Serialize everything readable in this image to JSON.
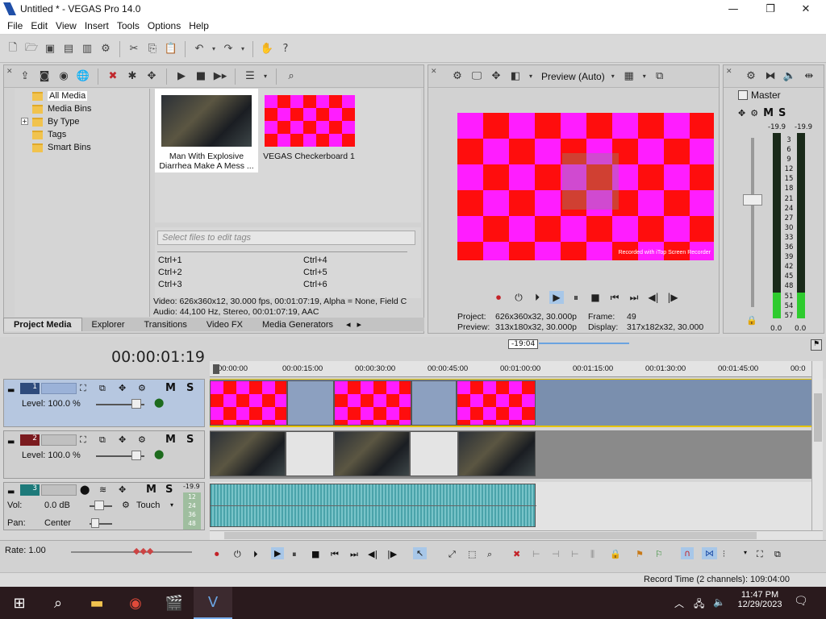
{
  "window": {
    "title": "Untitled * - VEGAS Pro 14.0",
    "minimize": "—",
    "maximize": "❐",
    "close": "✕"
  },
  "menu": [
    "File",
    "Edit",
    "View",
    "Insert",
    "Tools",
    "Options",
    "Help"
  ],
  "project_media": {
    "tree": [
      "All Media",
      "Media Bins",
      "By Type",
      "Tags",
      "Smart Bins"
    ],
    "expander": "+",
    "items": [
      {
        "caption": "Man With Explosive Diarrhea Make A Mess ..."
      },
      {
        "caption": "VEGAS Checkerboard 1"
      }
    ],
    "tag_placeholder": "Select files to edit tags",
    "shortcuts": [
      "Ctrl+1",
      "Ctrl+2",
      "Ctrl+3",
      "Ctrl+4",
      "Ctrl+5",
      "Ctrl+6"
    ],
    "info_line1": "Video: 626x360x12, 30.000 fps, 00:01:07:19, Alpha = None, Field C",
    "info_line2": "Audio: 44,100 Hz, Stereo, 00:01:07:19, AAC"
  },
  "tabs": [
    "Project Media",
    "Explorer",
    "Transitions",
    "Video FX",
    "Media Generators"
  ],
  "preview": {
    "mode": "Preview (Auto)",
    "project_label": "Project:",
    "project_value": "626x360x32, 30.000p",
    "preview_label": "Preview:",
    "preview_value": "313x180x32, 30.000p",
    "frame_label": "Frame:",
    "frame_value": "49",
    "display_label": "Display:",
    "display_value": "317x182x32, 30.000",
    "watermark": "Recorded with iTop Screen Recorder"
  },
  "master": {
    "title": "Master",
    "m": "M",
    "s": "S",
    "peak_left": "-19.9",
    "peak_right": "-19.9",
    "scale": [
      "3",
      "6",
      "9",
      "12",
      "15",
      "18",
      "21",
      "24",
      "27",
      "30",
      "33",
      "36",
      "39",
      "42",
      "45",
      "48",
      "51",
      "54",
      "57"
    ],
    "level_left": "0.0",
    "level_right": "0.0",
    "meter_fill": 0.14
  },
  "timeline": {
    "timecode": "00:00:01:19",
    "loop_region": "-19:04",
    "ruler": [
      "00:00:00",
      "00:00:15:00",
      "00:00:30:00",
      "00:00:45:00",
      "00:01:00:00",
      "00:01:15:00",
      "00:01:30:00",
      "00:01:45:00",
      "00:0"
    ],
    "tracks": [
      {
        "num": "1",
        "level": "Level: 100.0 %",
        "m": "M",
        "s": "S"
      },
      {
        "num": "2",
        "level": "Level: 100.0 %",
        "m": "M",
        "s": "S"
      },
      {
        "num": "3",
        "vol_label": "Vol:",
        "vol_value": "0.0 dB",
        "pan_label": "Pan:",
        "pan_value": "Center",
        "mode": "Touch",
        "m": "M",
        "s": "S",
        "peak": "-19.9",
        "scale": [
          "12",
          "24",
          "36",
          "48"
        ]
      }
    ]
  },
  "bottom": {
    "rate": "Rate: 1.00",
    "record_time": "Record Time (2 channels): 109:04:00"
  },
  "taskbar": {
    "time": "11:47 PM",
    "date": "12/29/2023"
  }
}
